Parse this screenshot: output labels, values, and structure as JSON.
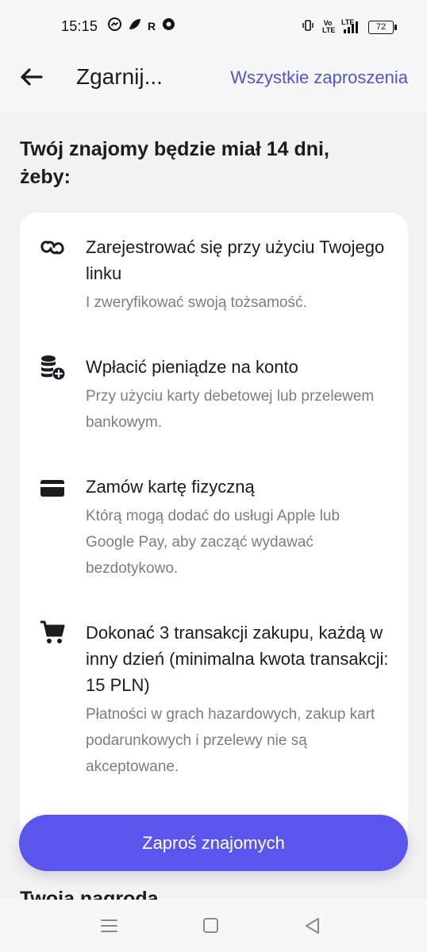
{
  "status_bar": {
    "time": "15:15",
    "left_icons": [
      "messenger-icon",
      "leaf-icon",
      "r-icon",
      "shield-icon"
    ],
    "r_letter": "R",
    "signal_text": "Vo LTE",
    "lte_text": "LTE",
    "battery": "72"
  },
  "header": {
    "title": "Zgarnij...",
    "all_invites_link": "Wszystkie zaproszenia",
    "accent_color": "#5353d8"
  },
  "main": {
    "title": "Twój znajomy będzie miał 14 dni, żeby:",
    "steps": [
      {
        "icon": "link-icon",
        "title": "Zarejestrować się przy użyciu Twojego linku",
        "description": "I zweryfikować swoją tożsamość."
      },
      {
        "icon": "coins-add-icon",
        "title": "Wpłacić pieniądze na konto",
        "description": "Przy użyciu karty debetowej lub przelewem bankowym."
      },
      {
        "icon": "card-icon",
        "title": "Zamów kartę fizyczną",
        "description": "Którą mogą dodać do usługi Apple lub Google Pay, aby zacząć wydawać bezdotykowo."
      },
      {
        "icon": "cart-icon",
        "title": "Dokonać 3 transakcji zakupu, każdą w inny dzień (minimalna kwota transakcji: 15 PLN)",
        "description": "Płatności w grach hazardowych, zakup kart podarunkowych i przelewy nie są akceptowane."
      }
    ],
    "invite_button": "Zaproś znajomych",
    "button_color": "#5b55ee",
    "reward_title": "Twoja nagroda"
  },
  "nav": {
    "items": [
      "menu-icon",
      "home-icon",
      "back-icon"
    ]
  }
}
